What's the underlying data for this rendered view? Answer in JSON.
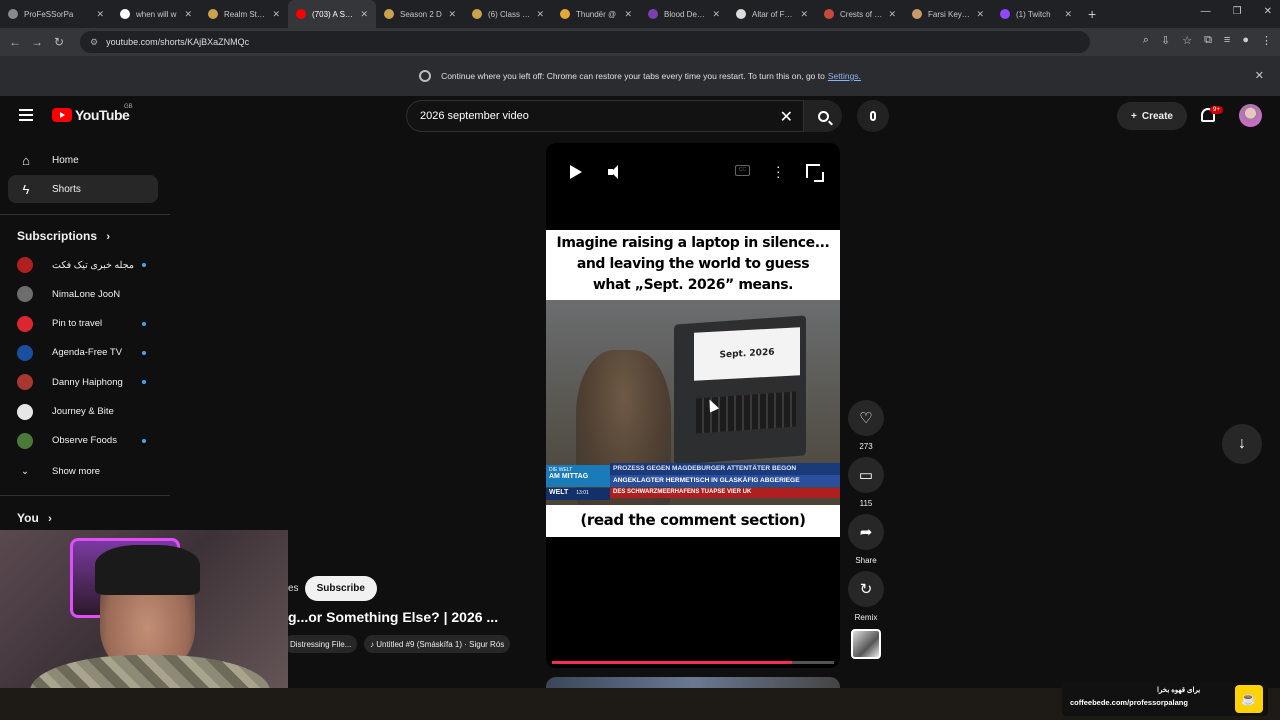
{
  "browser": {
    "tabs": [
      {
        "label": "ProFeSSorPa",
        "color": "#8a8a8a"
      },
      {
        "label": "when will w",
        "color": "#ffffff"
      },
      {
        "label": "Realm Statu",
        "color": "#c9a24b"
      },
      {
        "label": "(703) A Silen",
        "color": "#ff0000",
        "active": true
      },
      {
        "label": "Season 2 D",
        "color": "#c9a24b"
      },
      {
        "label": "(6) Class Tur",
        "color": "#c9a24b"
      },
      {
        "label": "Thundër @",
        "color": "#e4a73a"
      },
      {
        "label": "Blood Death",
        "color": "#7b3fb0"
      },
      {
        "label": "Altar of Fang",
        "color": "#dddddd"
      },
      {
        "label": "Crests of the",
        "color": "#c94a3a"
      },
      {
        "label": "Farsi Keybo",
        "color": "#c99a6a"
      },
      {
        "label": "(1) Twitch",
        "color": "#9146ff"
      }
    ],
    "url": "youtube.com/shorts/KAjBXaZNMQc",
    "restore_bar": {
      "message": "Continue where you left off: Chrome can restore your tabs every time you restart. To turn this on, go to",
      "link": "Settings."
    }
  },
  "header": {
    "logo_text": "YouTube",
    "region": "GB",
    "search_value": "2026 september video",
    "create_label": "Create",
    "notif_count": "9+"
  },
  "sidebar": {
    "items": [
      {
        "label": "Home",
        "icon": "home-icon"
      },
      {
        "label": "Shorts",
        "icon": "shorts-icon",
        "active": true
      }
    ],
    "subscriptions_title": "Subscriptions",
    "subscriptions": [
      {
        "label": "مجله خبری تیک فکت",
        "color": "#b0201e",
        "new": true
      },
      {
        "label": "NimaLone JooN",
        "color": "#6d6d6d",
        "new": false
      },
      {
        "label": "Pin to travel",
        "color": "#d9262f",
        "new": true
      },
      {
        "label": "Agenda-Free TV",
        "color": "#1a4f9e",
        "new": true
      },
      {
        "label": "Danny Haiphong",
        "color": "#a8382f",
        "new": true
      },
      {
        "label": "Journey & Bite",
        "color": "#e6e6e6",
        "new": false
      },
      {
        "label": "Observe Foods",
        "color": "#4a7a3a",
        "new": true
      }
    ],
    "show_more": "Show more",
    "you_title": "You"
  },
  "short": {
    "caption_top": "Imagine raising a laptop in silence...\nand leaving the world to guess\nwhat „Sept. 2026” means.",
    "caption_top_lines": [
      "Imagine raising a laptop in silence...",
      "and leaving the world to guess",
      "what „Sept. 2026” means."
    ],
    "laptop_text": "Sept. 2026",
    "ticker_channel": "AM MITTAG",
    "ticker_channel_top": "DIE WELT",
    "ticker_headline": "PROZESS GEGEN MAGDEBURGER ATTENTÄTER BEGON",
    "ticker_sub": "ANGEKLAGTER HERMETISCH IN GLASKÄFIG ABGERIEGE",
    "ticker_red": "DES SCHWARZMEERHAFENS TUAPSE VIER UK",
    "ticker_welt": "WELT",
    "ticker_time": "13:01",
    "caption_bottom": "(read the comment section)",
    "progress_fraction": 0.85,
    "channel_suffix": "es",
    "subscribe_label": "Subscribe",
    "title": "g...or Something Else? | 2026 ...",
    "tag_1": "Distressing File...",
    "tag_2": "♪ Untitled #9 (Smáskífa 1) · Sigur Rós"
  },
  "actions": {
    "likes": "273",
    "comments": "115",
    "share": "Share",
    "remix": "Remix"
  },
  "overlay": {
    "coffee_top": "برای قهوه بخرا",
    "coffee_url": "coffeebede.com/professorpalang"
  }
}
